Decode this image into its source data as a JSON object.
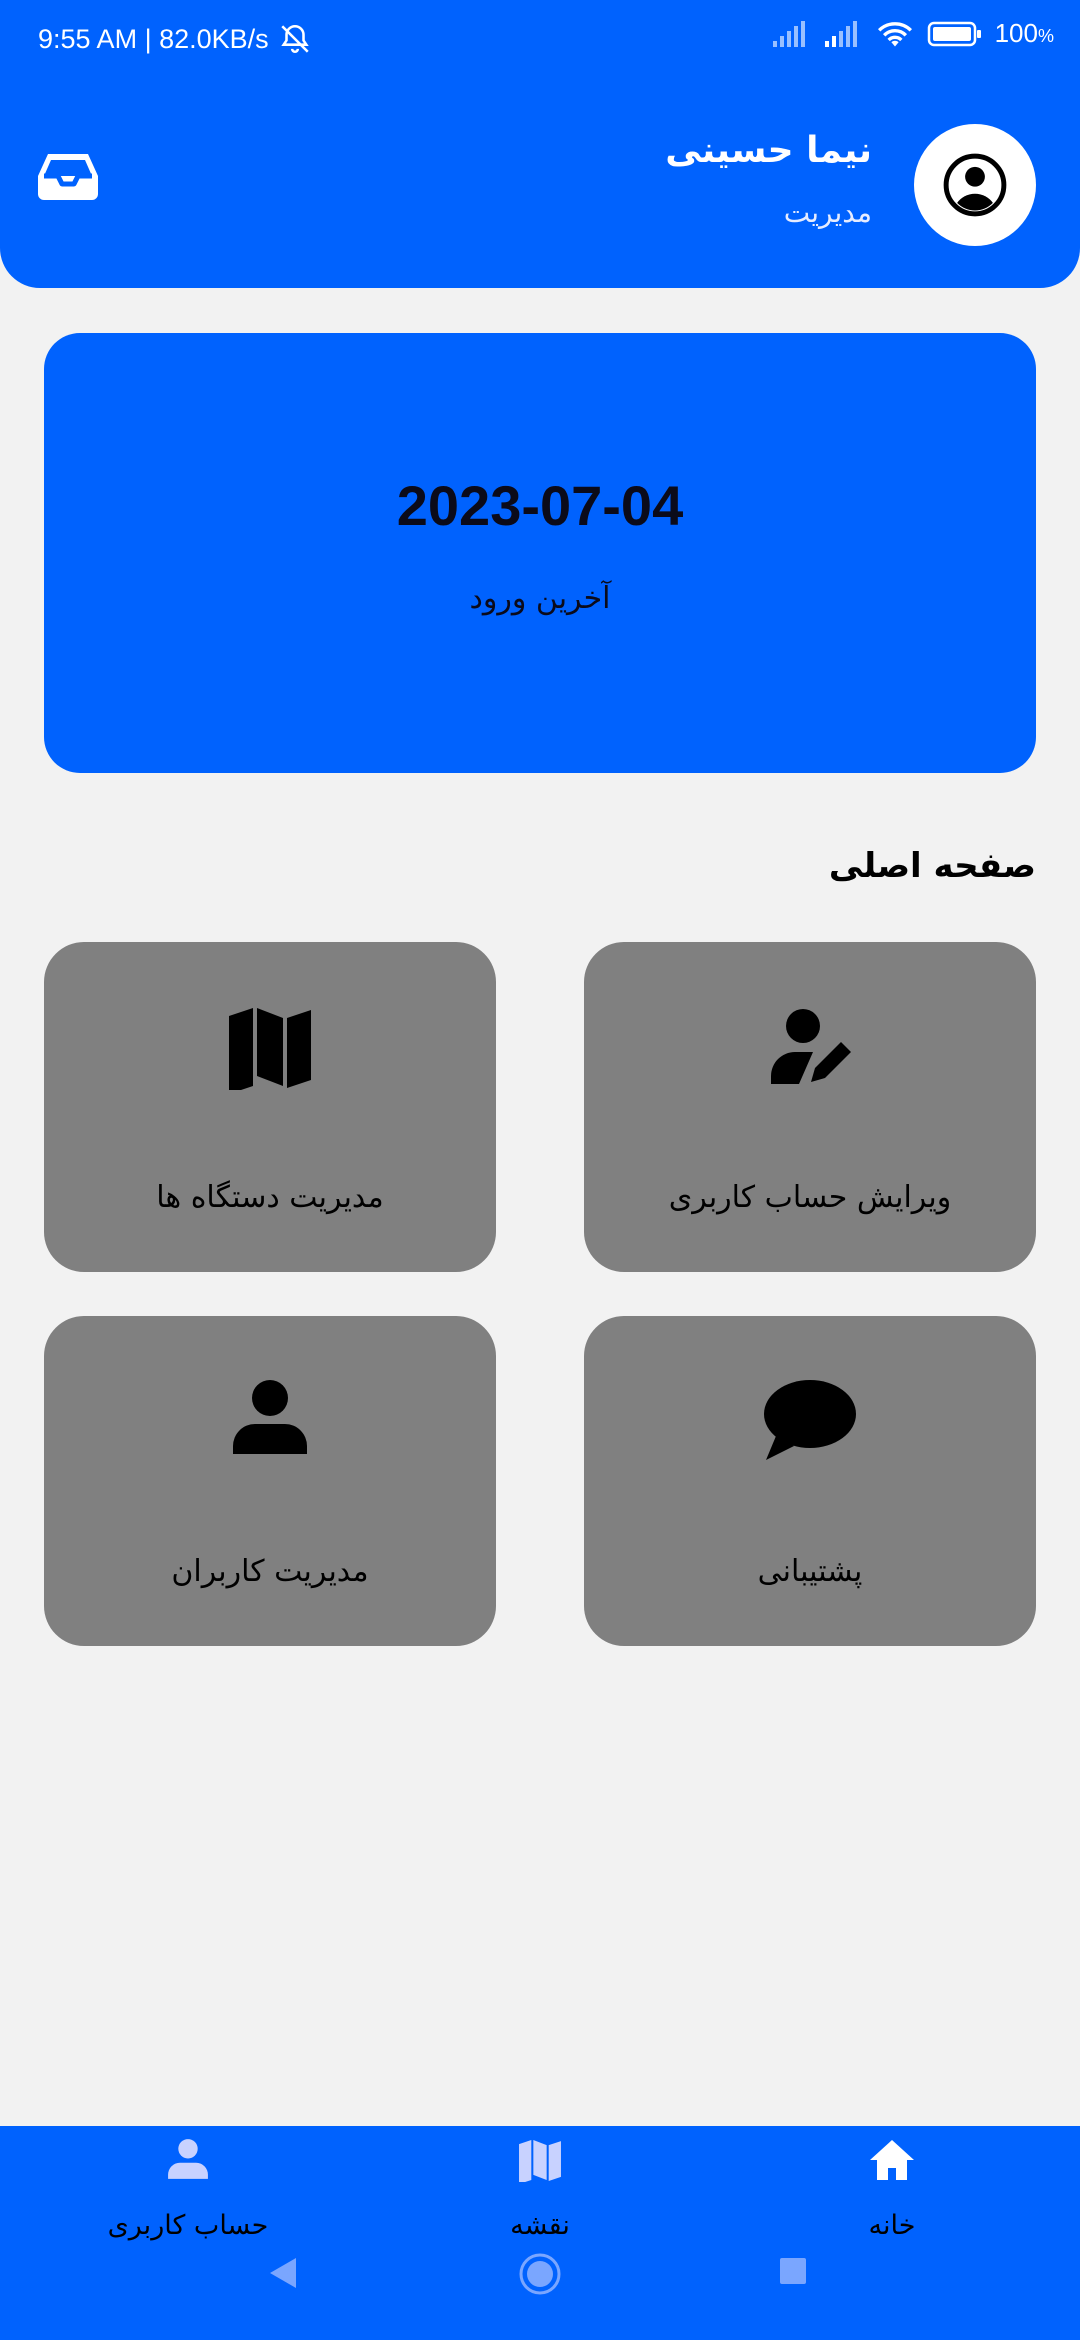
{
  "status_bar": {
    "time_speed": "9:55 AM | 82.0KB/s",
    "battery": "100",
    "battery_unit": "%"
  },
  "header": {
    "user_name": "نیما حسینی",
    "user_role": "مدیریت",
    "icons": {
      "inbox": "inbox-icon",
      "avatar": "account-circle-icon"
    }
  },
  "last_login": {
    "date": "2023-07-04",
    "label": "آخرین ورود"
  },
  "section": {
    "title": "صفحه اصلی"
  },
  "tiles": [
    {
      "label": "ویرایش حساب کاربری",
      "icon": "user-edit-icon"
    },
    {
      "label": "مدیریت دستگاه ها",
      "icon": "map-icon"
    },
    {
      "label": "پشتیبانی",
      "icon": "chat-bubble-icon"
    },
    {
      "label": "مدیریت کاربران",
      "icon": "user-icon"
    }
  ],
  "bottom_nav": [
    {
      "label": "خانه",
      "icon": "home-icon"
    },
    {
      "label": "نقشه",
      "icon": "map-icon"
    },
    {
      "label": "حساب کاربری",
      "icon": "user-icon"
    }
  ],
  "colors": {
    "primary": "#0062fe",
    "background": "#f2f2f2",
    "tile": "#808080",
    "text": "#000000",
    "nav_icon": "#c8d2ff"
  }
}
